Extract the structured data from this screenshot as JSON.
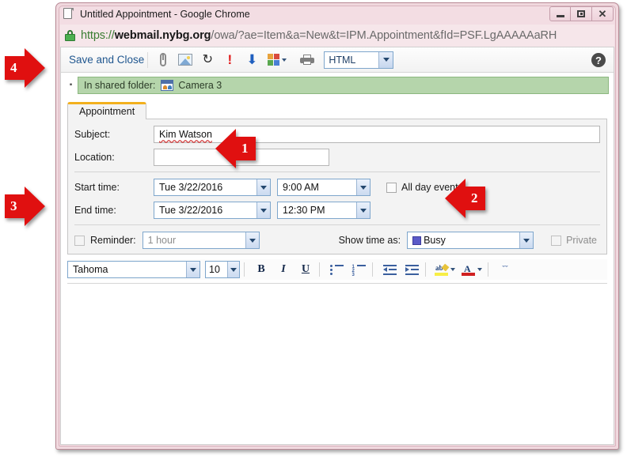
{
  "window": {
    "title": "Untitled Appointment - Google Chrome",
    "doc_icon": "document-icon",
    "minimize_label": "",
    "maximize_label": "",
    "close_label": "✕"
  },
  "address_bar": {
    "lock_icon": "padlock-icon",
    "url_scheme": "https://",
    "url_host": "webmail.nybg.org",
    "url_path": "/owa/?ae=Item&a=New&t=IPM.Appointment&fId=PSF.LgAAAAAaRH",
    "url_full": "https://webmail.nybg.org/owa/?ae=Item&a=New&t=IPM.Appointment&fId=PSF.LgAAAAAaRH"
  },
  "toolbar": {
    "save_and_close": "Save and Close",
    "attach_icon": "paperclip-icon",
    "insert_image_icon": "picture-icon",
    "recurrence_icon": "recurrence-icon",
    "high_importance_icon": "exclamation-icon",
    "low_importance_icon": "down-arrow-icon",
    "categories_icon": "categories-icon",
    "print_icon": "printer-icon",
    "format_value": "HTML",
    "help_label": "?"
  },
  "shared_folder": {
    "collapse_glyph": "▪",
    "label": "In shared folder:",
    "folder_icon": "shared-calendar-icon",
    "folder_name": "Camera 3"
  },
  "tabs": [
    {
      "label": "Appointment"
    }
  ],
  "form": {
    "subject_label": "Subject:",
    "subject_value": "Kim Watson",
    "location_label": "Location:",
    "location_value": "",
    "start_time_label": "Start time:",
    "start_date_value": "Tue 3/22/2016",
    "start_clock_value": "9:00 AM",
    "end_time_label": "End time:",
    "end_date_value": "Tue 3/22/2016",
    "end_clock_value": "12:30 PM",
    "all_day_label": "All day event",
    "all_day_checked": false,
    "reminder_label": "Reminder:",
    "reminder_value": "1 hour",
    "reminder_checked": false,
    "show_time_as_label": "Show time as:",
    "show_time_as_value": "Busy",
    "show_time_as_color": "#5a5ac8",
    "private_label": "Private",
    "private_checked": false
  },
  "rich_text_toolbar": {
    "font_value": "Tahoma",
    "size_value": "10",
    "bold_label": "B",
    "italic_label": "I",
    "underline_label": "U",
    "bullet_list_icon": "bulleted-list-icon",
    "number_list_icon": "numbered-list-icon",
    "decrease_indent_icon": "decrease-indent-icon",
    "increase_indent_icon": "increase-indent-icon",
    "highlight_icon": "highlight-icon",
    "font_color_icon": "font-color-icon",
    "more_label": "ˇˇ"
  },
  "body": {
    "content": ""
  },
  "callouts": [
    {
      "number": "1"
    },
    {
      "number": "2"
    },
    {
      "number": "3"
    },
    {
      "number": "4"
    }
  ],
  "colors": {
    "accent_red": "#e01010",
    "link_blue": "#20578f",
    "shared_bar_green": "#b5d5ab",
    "tab_highlight": "#f2b01e",
    "window_frame_pink": "#f0d8de"
  }
}
